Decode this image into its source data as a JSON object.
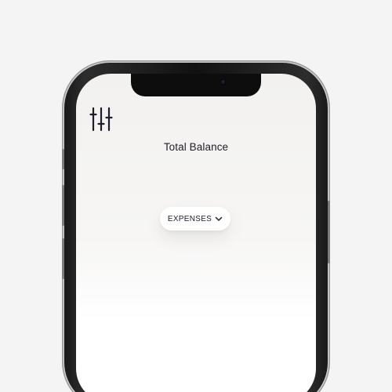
{
  "screen": {
    "balance_label": "Total Balance",
    "filter_icon": "sliders-icon"
  },
  "dropdown": {
    "selected": "EXPENSES",
    "icon": "chevron-down-icon"
  },
  "colors": {
    "background": "#f4f4f4",
    "frame": "#111111",
    "text": "#1d1d2b",
    "dropdown_bg": "#ffffff"
  }
}
